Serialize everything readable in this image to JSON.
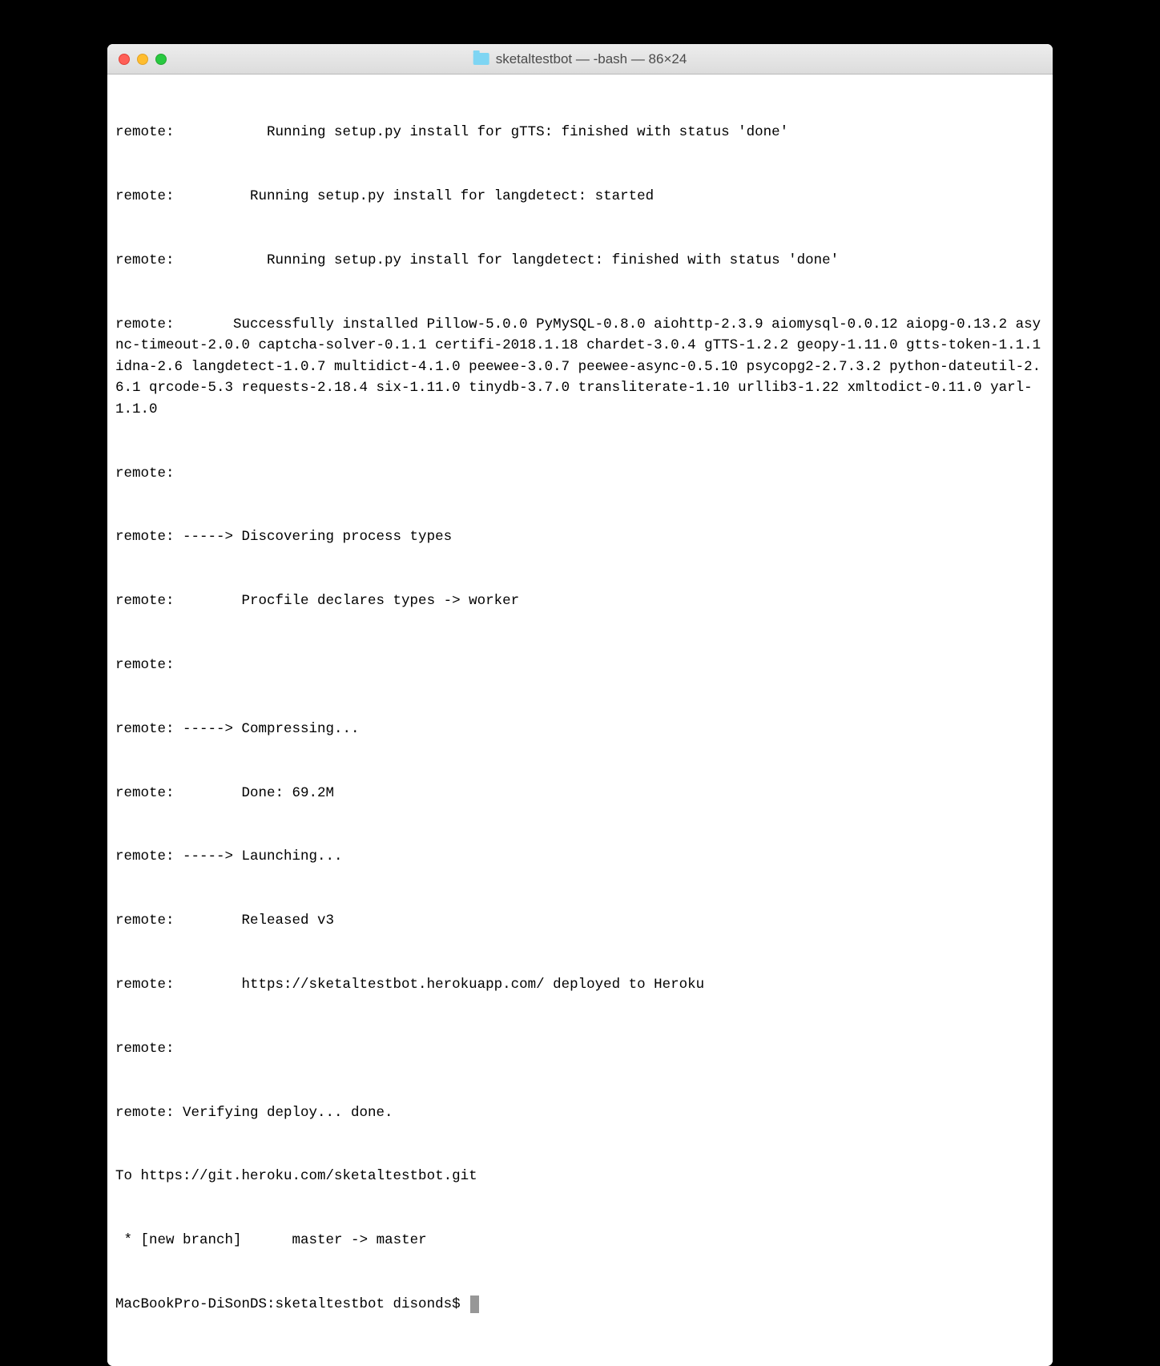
{
  "window": {
    "title": "sketaltestbot — -bash — 86×24"
  },
  "terminal": {
    "lines": [
      "remote:           Running setup.py install for gTTS: finished with status 'done'",
      "remote:         Running setup.py install for langdetect: started",
      "remote:           Running setup.py install for langdetect: finished with status 'done'",
      "remote:       Successfully installed Pillow-5.0.0 PyMySQL-0.8.0 aiohttp-2.3.9 aiomysql-0.0.12 aiopg-0.13.2 async-timeout-2.0.0 captcha-solver-0.1.1 certifi-2018.1.18 chardet-3.0.4 gTTS-1.2.2 geopy-1.11.0 gtts-token-1.1.1 idna-2.6 langdetect-1.0.7 multidict-4.1.0 peewee-3.0.7 peewee-async-0.5.10 psycopg2-2.7.3.2 python-dateutil-2.6.1 qrcode-5.3 requests-2.18.4 six-1.11.0 tinydb-3.7.0 transliterate-1.10 urllib3-1.22 xmltodict-0.11.0 yarl-1.1.0",
      "remote: ",
      "remote: -----> Discovering process types",
      "remote:        Procfile declares types -> worker",
      "remote: ",
      "remote: -----> Compressing...",
      "remote:        Done: 69.2M",
      "remote: -----> Launching...",
      "remote:        Released v3",
      "remote:        https://sketaltestbot.herokuapp.com/ deployed to Heroku",
      "remote: ",
      "remote: Verifying deploy... done.",
      "To https://git.heroku.com/sketaltestbot.git",
      " * [new branch]      master -> master"
    ],
    "prompt": "MacBookPro-DiSonDS:sketaltestbot disonds$ "
  }
}
